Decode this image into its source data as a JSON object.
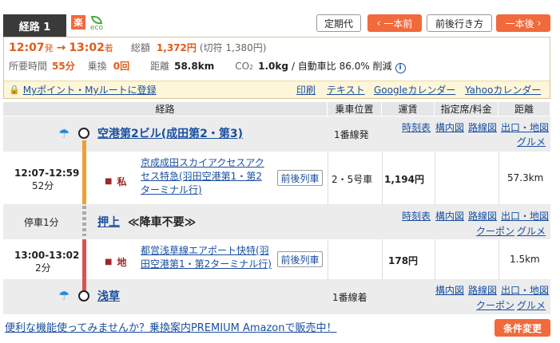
{
  "header": {
    "route_tab": "経路 1",
    "raku_badge": "楽",
    "eco_badge": "eco",
    "buttons": {
      "teikiken": "定期代",
      "prev": "一本前",
      "around": "前後行き方",
      "next": "一本後"
    }
  },
  "summary": {
    "dep_time": "12:07",
    "dep_suffix": "発",
    "arrow": "→",
    "arr_time": "13:02",
    "arr_suffix": "着",
    "fare_label": "総額",
    "fare_value": "1,372円",
    "fare_ticket": "(切符 1,380円)",
    "duration_label": "所要時間",
    "duration_value": "55分",
    "transfer_label": "乗換",
    "transfer_value": "0回",
    "distance_label": "距離",
    "distance_value": "58.8km",
    "co2_label": "CO",
    "co2_sub": "2",
    "co2_value": "1.0kg",
    "co2_compare": "/ 自動車比 86.0% 削減",
    "register_link": "Myポイント・Myルートに登録",
    "links": [
      "印刷",
      "テキスト",
      "Googleカレンダー",
      "Yahooカレンダー"
    ]
  },
  "table": {
    "headers": {
      "route": "経路",
      "position": "乗車位置",
      "fare": "運賃",
      "reserved": "指定席/料金",
      "distance": "距離"
    },
    "stations": [
      {
        "name": "空港第2ビル(成田第2・第3)",
        "platform": "1番線発",
        "links_row1": [
          "時刻表",
          "構内図",
          "路線図",
          "出口・地図"
        ],
        "links_row2": [
          "グルメ"
        ]
      },
      {
        "name": "押上",
        "note": "≪降車不要≫",
        "stop_text": "停車1分",
        "links_row1": [
          "時刻表",
          "構内図",
          "路線図",
          "出口・地図"
        ],
        "links_row2": [
          "クーポン",
          "グルメ"
        ]
      },
      {
        "name": "浅草",
        "platform": "1番線着",
        "links_row1": [
          "構内図",
          "路線図",
          "出口・地図"
        ],
        "links_row2": [
          "クーポン",
          "グルメ"
        ]
      }
    ],
    "segments": [
      {
        "time": "12:07-12:59",
        "duration": "52分",
        "badge1": "私",
        "line_name_1": "京成成田スカイアクセスアク",
        "line_name_2": "セス特急(羽田空港第1・第2",
        "line_name_3": "ターミナル行)",
        "button": "前後列車",
        "position": "2・5号車",
        "fare": "1,194円",
        "distance": "57.3km",
        "color": "#f0a030"
      },
      {
        "time": "13:00-13:02",
        "duration": "2分",
        "badge1": "地",
        "line_name_1": "都営浅草線エアポート快特(羽",
        "line_name_2": "田空港第1・第2ターミナル行)",
        "button": "前後列車",
        "fare": "178円",
        "distance": "1.5km",
        "color": "#d9534f"
      }
    ]
  },
  "footer": {
    "promo": "便利な機能使ってみませんか？乗換案内PREMIUM Amazonで販売中！",
    "cond_button": "条件変更"
  }
}
